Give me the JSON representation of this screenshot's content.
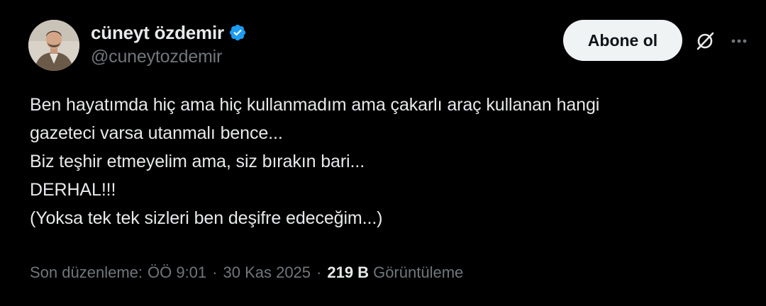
{
  "author": {
    "display_name": "cüneyt özdemir",
    "handle": "@cuneytozdemir",
    "verified_icon": "verified-badge-icon",
    "verified_color": "#1d9bf0"
  },
  "actions": {
    "follow_label": "Abone ol",
    "grok_icon": "grok-icon",
    "more_icon": "more-icon"
  },
  "tweet": {
    "lines": [
      "Ben hayatımda hiç ama hiç kullanmadım ama çakarlı araç kullanan hangi",
      "gazeteci varsa utanmalı bence...",
      "Biz teşhir etmeyelim ama, siz bırakın bari...",
      "DERHAL!!!",
      "(Yoksa tek tek sizleri ben deşifre edeceğim...)"
    ]
  },
  "meta": {
    "edited_label": "Son düzenleme:",
    "time": "ÖÖ 9:01",
    "separator": "·",
    "date": "30 Kas 2025",
    "views_count": "219 B",
    "views_label": "Görüntüleme"
  },
  "colors": {
    "background": "#000000",
    "primary_text": "#e7e9ea",
    "secondary_text": "#71767b",
    "button_bg": "#eff3f4"
  }
}
